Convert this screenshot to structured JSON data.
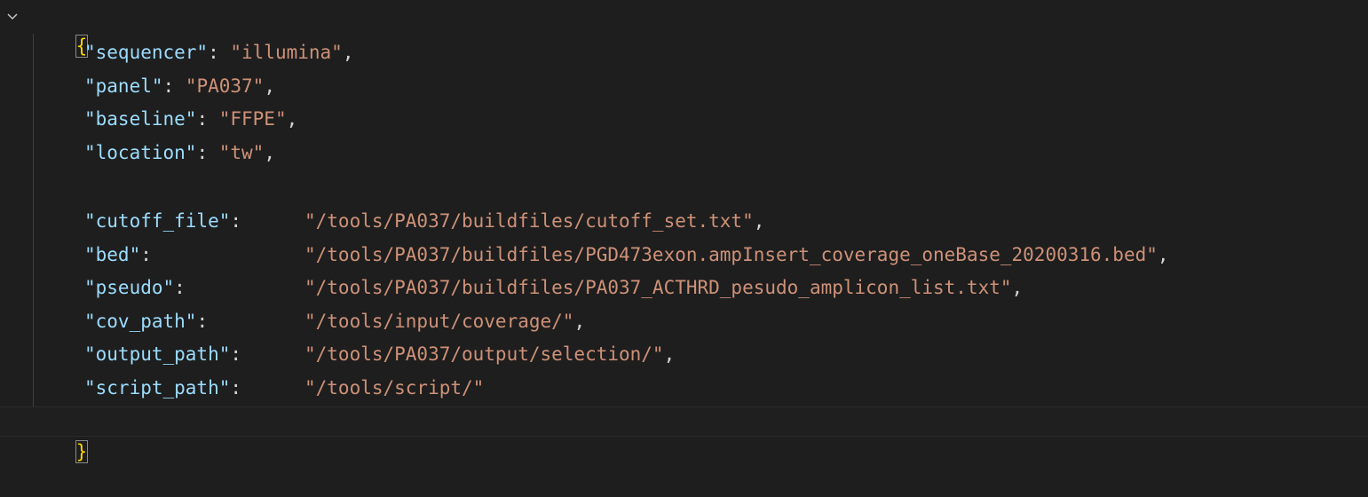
{
  "editor": {
    "open_brace": "{",
    "close_brace": "}",
    "fold_icon": "chevron-down-icon",
    "lines_group1": [
      {
        "key": "\"sequencer\"",
        "sep": ": ",
        "value": "\"illumina\"",
        "end": ","
      },
      {
        "key": "\"panel\"",
        "sep": ": ",
        "value": "\"PA037\"",
        "end": ","
      },
      {
        "key": "\"baseline\"",
        "sep": ": ",
        "value": "\"FFPE\"",
        "end": ","
      },
      {
        "key": "\"location\"",
        "sep": ": ",
        "value": "\"tw\"",
        "end": ","
      }
    ],
    "lines_group2": [
      {
        "key": "\"cutoff_file\"",
        "sep": ":",
        "value": "\"/tools/PA037/buildfiles/cutoff_set.txt\"",
        "end": ","
      },
      {
        "key": "\"bed\"",
        "sep": ":",
        "value": "\"/tools/PA037/buildfiles/PGD473exon.ampInsert_coverage_oneBase_20200316.bed\"",
        "end": ","
      },
      {
        "key": "\"pseudo\"",
        "sep": ":",
        "value": "\"/tools/PA037/buildfiles/PA037_ACTHRD_pesudo_amplicon_list.txt\"",
        "end": ","
      },
      {
        "key": "\"cov_path\"",
        "sep": ":",
        "value": "\"/tools/input/coverage/\"",
        "end": ","
      },
      {
        "key": "\"output_path\"",
        "sep": ":",
        "value": "\"/tools/PA037/output/selection/\"",
        "end": ","
      },
      {
        "key": "\"script_path\"",
        "sep": ":",
        "value": "\"/tools/script/\"",
        "end": ""
      }
    ]
  },
  "colors": {
    "background": "#1e1e1e",
    "key": "#9cdcfe",
    "string": "#ce9178",
    "punctuation": "#d4d4d4",
    "bracket": "#ffd700"
  }
}
